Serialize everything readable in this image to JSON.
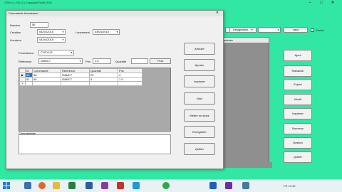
{
  "main": {
    "title": "CSM v1.234 (C) Copyright Swift 2015",
    "toolbar": {
      "designation_label": "Désignation",
      "valid_button": "Valid",
      "checkbox_label": "Stocks"
    },
    "grid_header": "Commentaire",
    "side_buttons": [
      "Ajout",
      "Rafraichir",
      "Export",
      "Modif",
      "Imprimer",
      "Nouveau",
      "Gestion",
      "Quitter"
    ]
  },
  "dialog": {
    "title": "Commande fournisseur",
    "numero_label": "Numéro",
    "numero_value": "56",
    "creation_label": "Création",
    "creation_value": "04/04/2015",
    "lancement_label": "Lancement",
    "lancement_value": "04/04/2015",
    "livraison_label": "Livraison",
    "livraison_value": "04/04/2015",
    "fournisseur_label": "Fournisseur",
    "fournisseur_value": "COFYUS",
    "reference_label": "Référence",
    "reference_value": "I28MC7",
    "prix_label": "Prix",
    "prix_value": "1.5",
    "quantite_label": "Quantité",
    "find_button": "Find",
    "grid": {
      "columns": [
        "Id",
        "Commande",
        "Référence",
        "Quantité",
        "Prix"
      ],
      "rows": [
        {
          "marker": "▶",
          "id": "50",
          "commande": "56",
          "reference": "I28MC7",
          "quantite": "20",
          "prix": "4"
        },
        {
          "marker": "",
          "id": "51",
          "commande": "56",
          "reference": "I28MC7",
          "quantite": "5",
          "prix": "1.5"
        },
        {
          "marker": "*",
          "id": "",
          "commande": "",
          "reference": "",
          "quantite": "",
          "prix": ""
        }
      ]
    },
    "commentaire_label": "Commentaire",
    "buttons": [
      "Annuler",
      "Ajouter",
      "Imprimer",
      "Mail",
      "Mettre en stock",
      "Enregistrer",
      "Quitter"
    ]
  },
  "taskbar": {
    "tray_text": "FR  12:49",
    "icons": [
      "start-icon",
      "shark-icon",
      "firefox-icon",
      "folder-icon",
      "media-icon",
      "word-icon",
      "excel-icon",
      "pdf-icon",
      "skype-icon",
      "chrome-icon",
      "outlook-icon",
      "vs-icon",
      "app-icon"
    ]
  },
  "colors": {
    "background": "#32e7a4",
    "selection": "#2f6fd1"
  }
}
